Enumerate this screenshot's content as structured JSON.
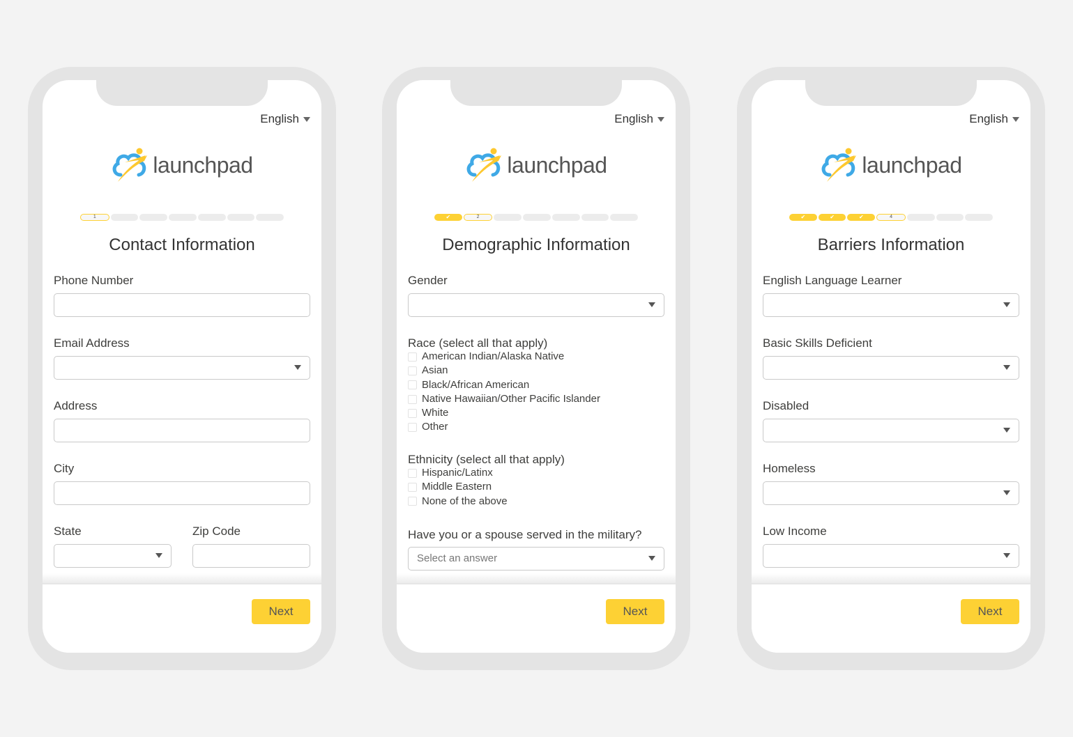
{
  "colors": {
    "accent": "#fdd134",
    "background": "#f3f3f3",
    "frame": "#e4e4e4"
  },
  "screens": [
    {
      "language": "English",
      "logo": "launchpad",
      "progress": {
        "total_steps": 7,
        "current_step": 1,
        "labels": [
          "1"
        ]
      },
      "title": "Contact Information",
      "fields": {
        "phone": "Phone Number",
        "email": "Email Address",
        "address": "Address",
        "city": "City",
        "state": "State",
        "zip": "Zip Code"
      },
      "next_label": "Next"
    },
    {
      "language": "English",
      "logo": "launchpad",
      "progress": {
        "total_steps": 7,
        "current_step": 2,
        "labels": [
          "2"
        ]
      },
      "title": "Demographic Information",
      "gender_label": "Gender",
      "race_label": "Race (select all that apply)",
      "race_options": [
        "American Indian/Alaska Native",
        "Asian",
        "Black/African American",
        "Native Hawaiian/Other Pacific Islander",
        "White",
        "Other"
      ],
      "ethnicity_label": "Ethnicity (select all that apply)",
      "ethnicity_options": [
        "Hispanic/Latinx",
        "Middle Eastern",
        "None of the above"
      ],
      "military_label": "Have you or a spouse served in the military?",
      "military_placeholder": "Select an answer",
      "next_label": "Next"
    },
    {
      "language": "English",
      "logo": "launchpad",
      "progress": {
        "total_steps": 7,
        "current_step": 4,
        "labels": [
          "4"
        ]
      },
      "title": "Barriers Information",
      "fields": {
        "ell": "English Language Learner",
        "basic_skills": "Basic Skills Deficient",
        "disabled": "Disabled",
        "homeless": "Homeless",
        "low_income": "Low Income"
      },
      "next_label": "Next"
    }
  ]
}
